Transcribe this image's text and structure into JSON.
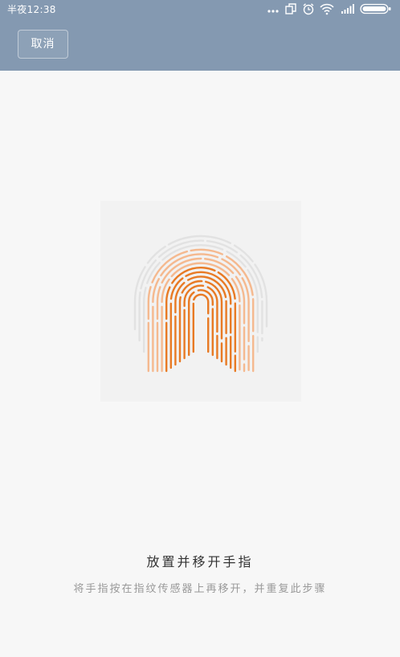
{
  "status_bar": {
    "time": "半夜12:38",
    "icons": [
      "more-dots-icon",
      "screen-rotate-icon",
      "alarm-icon",
      "wifi-icon",
      "signal-icon",
      "battery-icon"
    ]
  },
  "header": {
    "cancel_label": "取消"
  },
  "content": {
    "title": "放置并移开手指",
    "instruction": "将手指按在指纹传感器上再移开，并重复此步骤"
  },
  "colors": {
    "header_bg": "#8499b1",
    "page_bg": "#f7f7f7",
    "fingerprint_gray": "#e2e2e2",
    "fingerprint_light": "#f5b98f",
    "fingerprint_dark": "#e87a24"
  }
}
